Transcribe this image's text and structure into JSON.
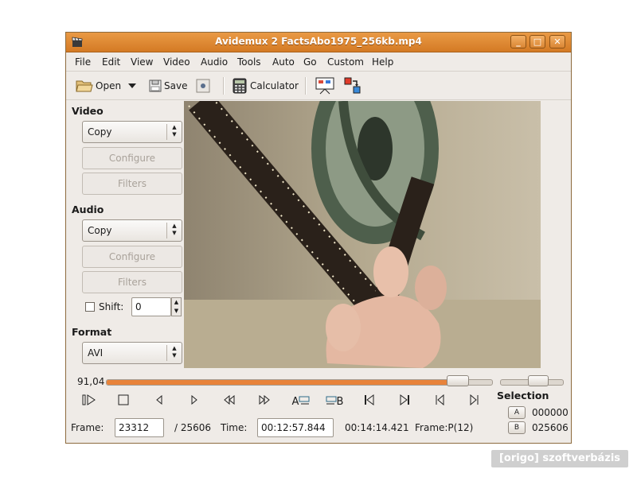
{
  "window": {
    "title": "Avidemux 2 FactsAbo1975_256kb.mp4",
    "minimize_glyph": "_",
    "maximize_glyph": "□",
    "close_glyph": "✕"
  },
  "menu": {
    "items": [
      "File",
      "Edit",
      "View",
      "Video",
      "Audio",
      "Tools",
      "Auto",
      "Go",
      "Custom",
      "Help"
    ]
  },
  "toolbar": {
    "open_label": "Open",
    "save_label": "Save",
    "calculator_label": "Calculator"
  },
  "sidebar": {
    "video_title": "Video",
    "video_codec": "Copy",
    "video_configure": "Configure",
    "video_filters": "Filters",
    "audio_title": "Audio",
    "audio_codec": "Copy",
    "audio_configure": "Configure",
    "audio_filters": "Filters",
    "shift_label": "Shift:",
    "shift_value": "0",
    "format_title": "Format",
    "format_value": "AVI"
  },
  "seek": {
    "position_label": "91,04",
    "position_fraction": 0.9104
  },
  "controls": {
    "mark_a_label": "A",
    "mark_b_label": "B",
    "selection_title": "Selection",
    "selection_a_btn": "A",
    "selection_a_value": "000000",
    "selection_b_btn": "B",
    "selection_b_value": "025606"
  },
  "status": {
    "frame_label": "Frame:",
    "frame_value": "23312",
    "frame_total": "/ 25606",
    "time_label": "Time:",
    "time_value": "00:12:57.844",
    "duration": "00:14:14.421",
    "frame_type": "Frame:P(12)"
  },
  "watermark": "[origo] szoftverbázis",
  "colors": {
    "titlebar": "#d98533",
    "seek_fill": "#e8833a",
    "window_bg": "#efebe7"
  }
}
